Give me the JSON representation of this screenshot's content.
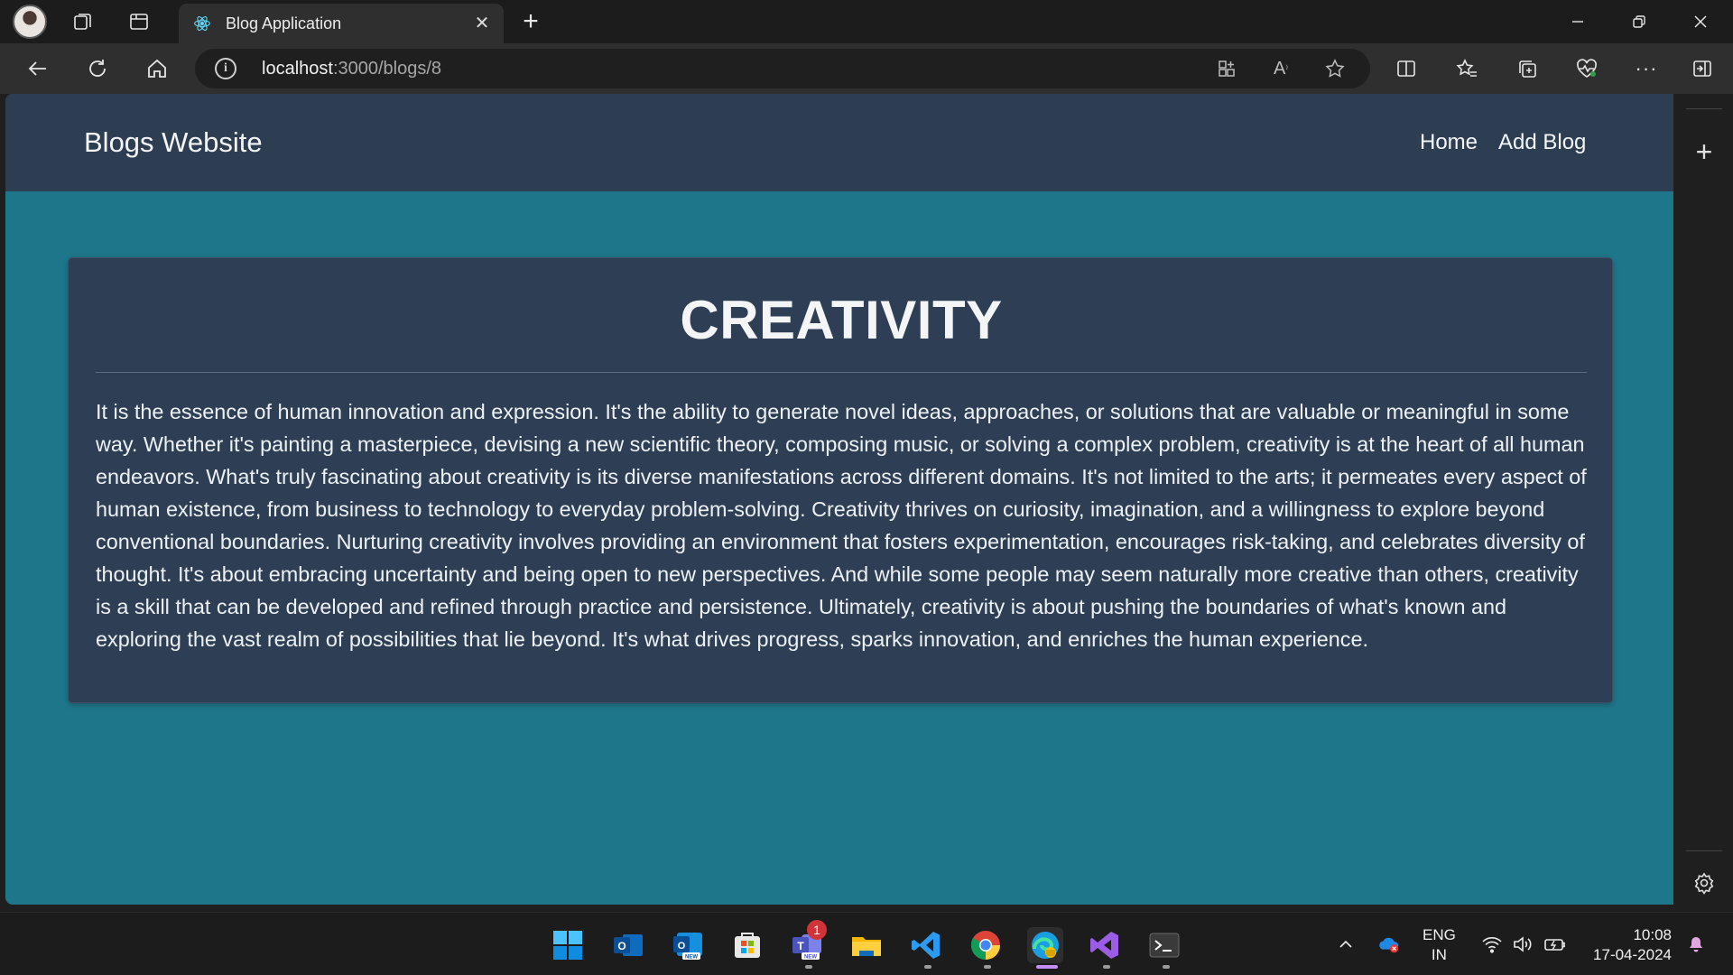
{
  "browser": {
    "tab_title": "Blog Application",
    "url_host": "localhost",
    "url_path": ":3000/blogs/8"
  },
  "site": {
    "brand": "Blogs Website",
    "nav": {
      "home": "Home",
      "add_blog": "Add Blog"
    }
  },
  "post": {
    "title": "CREATIVITY",
    "body": "It is the essence of human innovation and expression. It's the ability to generate novel ideas, approaches, or solutions that are valuable or meaningful in some way. Whether it's painting a masterpiece, devising a new scientific theory, composing music, or solving a complex problem, creativity is at the heart of all human endeavors. What's truly fascinating about creativity is its diverse manifestations across different domains. It's not limited to the arts; it permeates every aspect of human existence, from business to technology to everyday problem-solving. Creativity thrives on curiosity, imagination, and a willingness to explore beyond conventional boundaries. Nurturing creativity involves providing an environment that fosters experimentation, encourages risk-taking, and celebrates diversity of thought. It's about embracing uncertainty and being open to new perspectives. And while some people may seem naturally more creative than others, creativity is a skill that can be developed and refined through practice and persistence. Ultimately, creativity is about pushing the boundaries of what's known and exploring the vast realm of possibilities that lie beyond. It's what drives progress, sparks innovation, and enriches the human experience."
  },
  "taskbar": {
    "teams_badge": "1",
    "lang_top": "ENG",
    "lang_bottom": "IN",
    "time": "10:08",
    "date": "17-04-2024"
  },
  "colors": {
    "page_bg": "#1e768b",
    "header_bg": "#2d3e53",
    "card_bg": "#2e3f55"
  }
}
